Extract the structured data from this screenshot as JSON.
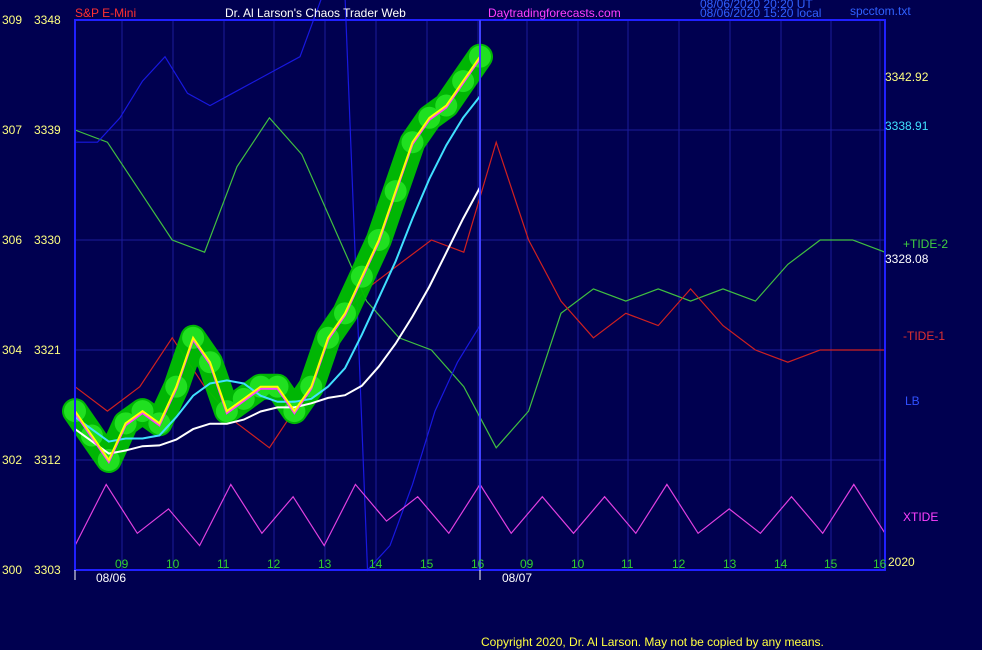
{
  "header": {
    "symbol": "S&P E-Mini",
    "title": "Dr. Al Larson's Chaos Trader Web",
    "site": "Daytradingforecasts.com",
    "time_utc": "08/06/2020 20:20 UT",
    "time_local": "08/06/2020 15:20 local",
    "filename": "spcctom.txt"
  },
  "footer": {
    "copyright": "Copyright 2020, Dr. Al Larson. May not be copied by any means."
  },
  "chart_data": {
    "type": "line",
    "y_axis_left": [
      {
        "angle": "309",
        "price": "3348"
      },
      {
        "angle": "307",
        "price": "3339"
      },
      {
        "angle": "306",
        "price": "3330"
      },
      {
        "angle": "304",
        "price": "3321"
      },
      {
        "angle": "302",
        "price": "3312"
      },
      {
        "angle": "300",
        "price": "3303"
      }
    ],
    "ylim": [
      3303,
      3348
    ],
    "x_ticks_day1": [
      "09",
      "10",
      "11",
      "12",
      "13",
      "14",
      "15",
      "16"
    ],
    "x_ticks_day2": [
      "09",
      "10",
      "11",
      "12",
      "13",
      "14",
      "15",
      "16"
    ],
    "date1": "08/06",
    "date2": "08/07",
    "year": "2020",
    "right_labels": {
      "price_high": "3342.92",
      "price_cyan": "3338.91",
      "price_mid": "3328.08",
      "tide2": "+TIDE-2",
      "tide1": "-TIDE-1",
      "lb": "LB",
      "xtide": "XTIDE"
    },
    "colors": {
      "background": "#000050",
      "frame": "#2020ff",
      "price": "#ffff00",
      "glow": "#00c000",
      "cyan_ma": "#40e0ff",
      "white_ma": "#ffffff",
      "tide2": "#40c040",
      "tide1": "#d02020",
      "lb": "#1818e0",
      "xtide": "#e040e0",
      "left_labels": "#ffff80"
    },
    "series": [
      {
        "name": "+TIDE-2",
        "values": [
          3339,
          3338,
          3334,
          3330,
          3329,
          3336,
          3340,
          3337,
          3331,
          3325,
          3322,
          3321,
          3318,
          3313,
          3316,
          3324,
          3326,
          3325,
          3326,
          3325,
          3326,
          3325,
          3328,
          3330,
          3330,
          3329
        ]
      },
      {
        "name": "-TIDE-1",
        "values": [
          3318,
          3316,
          3318,
          3322,
          3318,
          3315,
          3313,
          3317,
          3323,
          3326,
          3328,
          3330,
          3329,
          3338,
          3330,
          3325,
          3322,
          3324,
          3323,
          3326,
          3323,
          3321,
          3320,
          3321,
          3321,
          3321
        ]
      },
      {
        "name": "LB",
        "values": [
          3338,
          3338,
          3340,
          3343,
          3345,
          3342,
          3341,
          3342,
          3343,
          3344,
          3345,
          3350,
          3350,
          3303,
          3305,
          3310,
          3316,
          3320,
          3323
        ]
      },
      {
        "name": "XTIDE",
        "values": [
          3305,
          3310,
          3306,
          3308,
          3305,
          3310,
          3306,
          3309,
          3305,
          3310,
          3307,
          3309,
          3306,
          3310,
          3306,
          3309,
          3306,
          3309,
          3306,
          3310,
          3306,
          3308,
          3306,
          3309,
          3306,
          3310,
          3306
        ]
      },
      {
        "name": "",
        "values": [
          3316,
          3314,
          3312,
          3315,
          3316,
          3315,
          3318,
          3322,
          3320,
          3316,
          3317,
          3318,
          3318,
          3316,
          3318,
          3322,
          3324,
          3327,
          3330,
          3334,
          3338,
          3340,
          3341,
          3343,
          3345
        ]
      }
    ]
  }
}
